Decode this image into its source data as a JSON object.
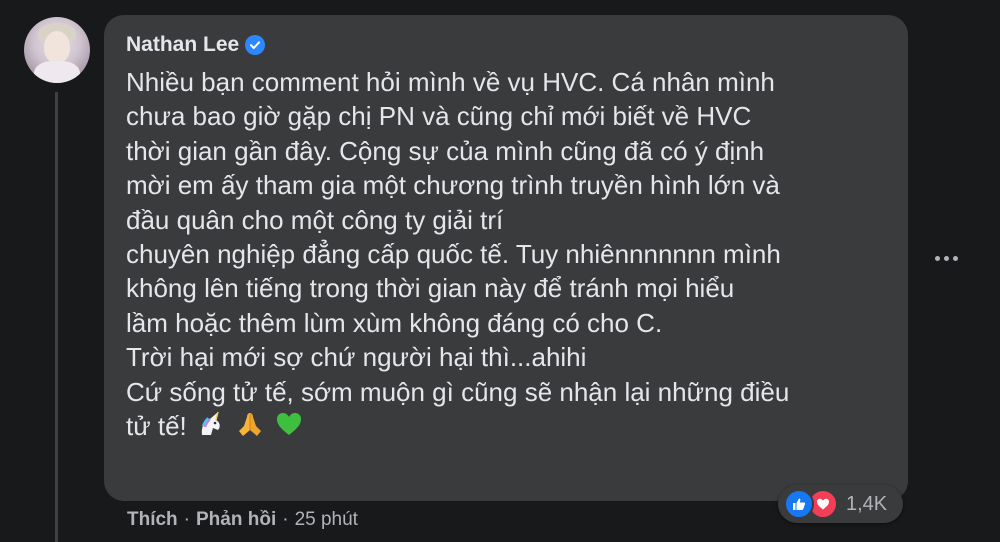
{
  "comment": {
    "author": "Nathan Lee",
    "verified_icon": "verified-badge-icon",
    "text_lines": [
      "Nhiều bạn comment hỏi mình về vụ HVC. Cá nhân mình",
      "chưa bao giờ gặp chị PN và cũng chỉ mới biết về HVC",
      "thời gian gần đây. Cộng sự của mình cũng đã có ý định",
      "mời em ấy tham gia một chương trình truyền hình lớn và",
      "đầu quân cho một công ty giải trí",
      "chuyên nghiệp đẳng cấp quốc tế. Tuy nhiênnnnnnn mình",
      "không lên tiếng trong thời gian này để tránh mọi hiểu",
      "lầm hoặc thêm lùm xùm không đáng có cho C.",
      "Trời hại mới sợ chứ người hại thì...ahihi",
      "Cứ sống tử tế, sớm muộn gì cũng sẽ nhận lại những điều",
      "tử tế!"
    ],
    "emojis": [
      "unicorn",
      "folded-hands",
      "green-heart"
    ],
    "reaction_count": "1,4K",
    "reaction_icons": [
      "like",
      "love"
    ]
  },
  "actions": {
    "like_label": "Thích",
    "reply_label": "Phản hồi",
    "separator": "·",
    "time": "25 phút"
  },
  "colors": {
    "background": "#18191a",
    "bubble": "#3a3b3c",
    "text": "#e4e6eb",
    "muted": "#b0b3b8",
    "like": "#1877f2",
    "love": "#f33e58",
    "verified": "#2d88ff"
  }
}
